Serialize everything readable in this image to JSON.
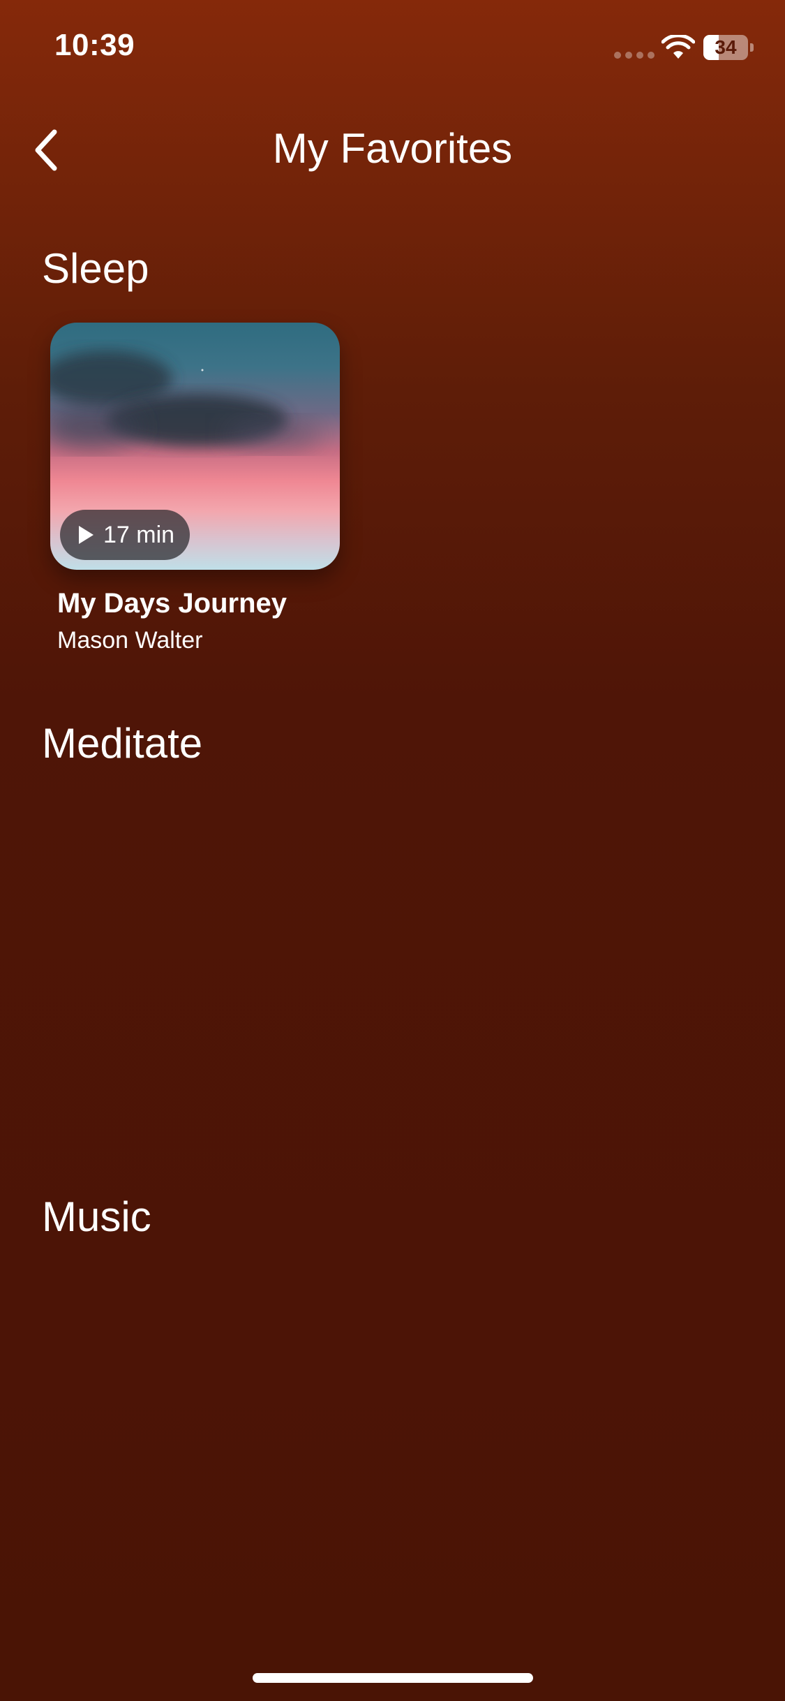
{
  "status_bar": {
    "time": "10:39",
    "battery_level": "34",
    "battery_fraction": 0.34,
    "wifi_icon": "wifi-icon",
    "signal_icon": "cellular-signal-icon"
  },
  "header": {
    "back_icon": "chevron-left-icon",
    "title": "My Favorites"
  },
  "sections": [
    {
      "title": "Sleep",
      "items": [
        {
          "title": "My Days Journey",
          "author": "Mason Walter",
          "duration": "17 min",
          "play_icon": "play-icon"
        }
      ]
    },
    {
      "title": "Meditate",
      "items": []
    },
    {
      "title": "Music",
      "items": []
    }
  ],
  "colors": {
    "background_top": "#85290a",
    "background_bottom": "#4a1405",
    "text": "#ffffff"
  }
}
